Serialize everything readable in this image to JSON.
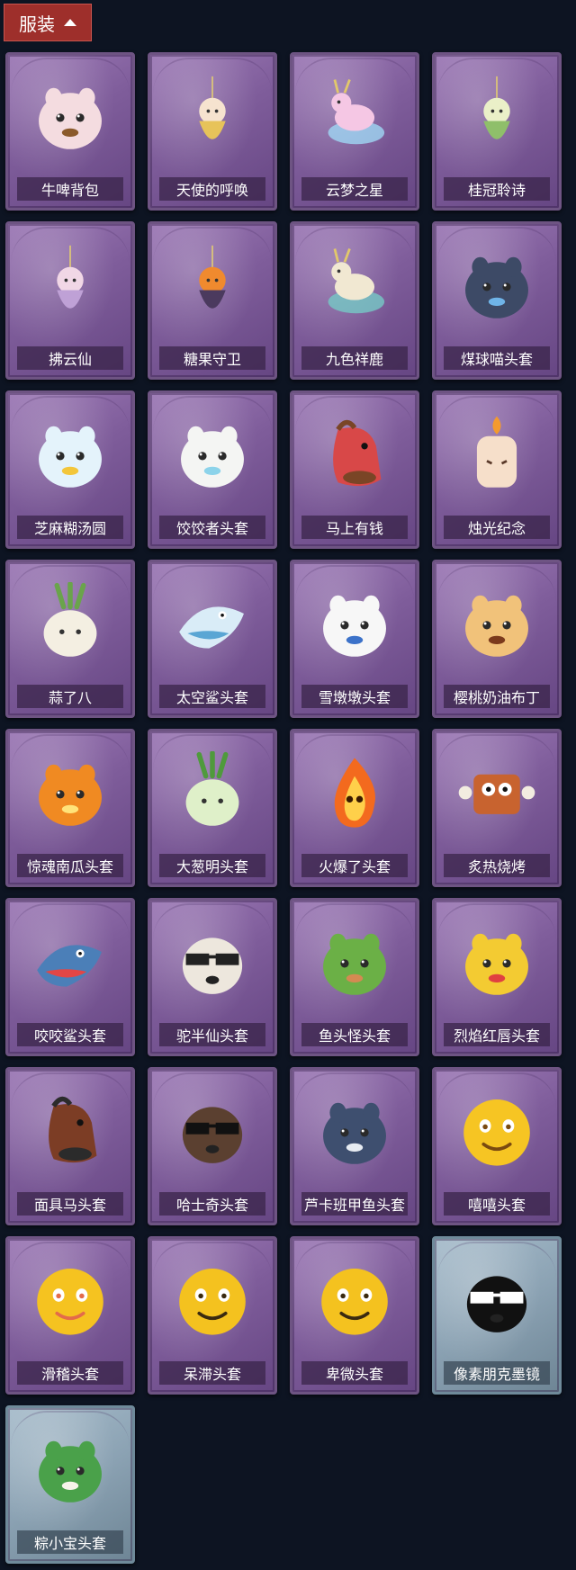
{
  "header": {
    "title": "服装",
    "icon": "chevron-up-icon",
    "color": "#9e2f2b"
  },
  "items": [
    {
      "label": "牛啤背包",
      "color": "#f4dce0",
      "accent": "#8b5a2b",
      "frame": "purple",
      "icon": "cow-beer-backpack-icon"
    },
    {
      "label": "天使的呼唤",
      "color": "#f6e3cf",
      "accent": "#e7c35a",
      "frame": "purple",
      "icon": "angel-pendant-icon"
    },
    {
      "label": "云梦之星",
      "color": "#f5c7e4",
      "accent": "#9fd7f4",
      "frame": "purple",
      "icon": "unicorn-cloud-icon"
    },
    {
      "label": "桂冠聆诗",
      "color": "#eaf0c8",
      "accent": "#8fbf6a",
      "frame": "purple",
      "icon": "laurel-pendant-icon"
    },
    {
      "label": "拂云仙",
      "color": "#f1d7e6",
      "accent": "#bfa1d6",
      "frame": "purple",
      "icon": "cloud-fairy-pendant-icon"
    },
    {
      "label": "糖果守卫",
      "color": "#f08a2e",
      "accent": "#4b3a5e",
      "frame": "purple",
      "icon": "pumpkin-guard-pendant-icon"
    },
    {
      "label": "九色祥鹿",
      "color": "#f1e8d2",
      "accent": "#76c9c6",
      "frame": "purple",
      "icon": "deer-icon"
    },
    {
      "label": "煤球喵头套",
      "color": "#3d4a66",
      "accent": "#6fb4e8",
      "frame": "purple",
      "icon": "black-cat-head-icon"
    },
    {
      "label": "芝麻糊汤圆",
      "color": "#e4f3fb",
      "accent": "#f3c63a",
      "frame": "purple",
      "icon": "tangyuan-head-icon"
    },
    {
      "label": "饺饺者头套",
      "color": "#f4f5f3",
      "accent": "#8cd3ea",
      "frame": "purple",
      "icon": "dumpling-head-icon"
    },
    {
      "label": "马上有钱",
      "color": "#d84848",
      "accent": "#7a4526",
      "frame": "purple",
      "icon": "red-horse-head-icon"
    },
    {
      "label": "烛光纪念",
      "color": "#f6dfca",
      "accent": "#f39a2e",
      "frame": "purple",
      "icon": "candle-head-icon"
    },
    {
      "label": "蒜了八",
      "color": "#f4efe2",
      "accent": "#6aa44b",
      "frame": "purple",
      "icon": "garlic-head-icon"
    },
    {
      "label": "太空鲨头套",
      "color": "#d9ecf7",
      "accent": "#5aa6d4",
      "frame": "purple",
      "icon": "space-shark-head-icon"
    },
    {
      "label": "雪墩墩头套",
      "color": "#f7f7f7",
      "accent": "#3c72c9",
      "frame": "purple",
      "icon": "snowman-head-icon"
    },
    {
      "label": "樱桃奶油布丁",
      "color": "#f1c27a",
      "accent": "#7b3a1c",
      "frame": "purple",
      "icon": "pudding-head-icon"
    },
    {
      "label": "惊魂南瓜头套",
      "color": "#f08a22",
      "accent": "#ffe37a",
      "frame": "purple",
      "icon": "jack-o-lantern-head-icon"
    },
    {
      "label": "大葱明头套",
      "color": "#dff0c9",
      "accent": "#4f9a3c",
      "frame": "purple",
      "icon": "scallion-head-icon"
    },
    {
      "label": "火爆了头套",
      "color": "#f36a1e",
      "accent": "#ffd04a",
      "frame": "purple",
      "icon": "fire-head-icon"
    },
    {
      "label": "炙热烧烤",
      "color": "#c8632f",
      "accent": "#f2ece0",
      "frame": "purple",
      "icon": "bbq-meat-head-icon"
    },
    {
      "label": "咬咬鲨头套",
      "color": "#4b7fb8",
      "accent": "#e24646",
      "frame": "purple",
      "icon": "biting-shark-head-icon"
    },
    {
      "label": "驼半仙头套",
      "color": "#ede7dd",
      "accent": "#222222",
      "frame": "purple",
      "icon": "alpaca-sunglasses-head-icon"
    },
    {
      "label": "鱼头怪头套",
      "color": "#6bb046",
      "accent": "#d48a52",
      "frame": "purple",
      "icon": "fish-head-mask-icon"
    },
    {
      "label": "烈焰红唇头套",
      "color": "#f3cb32",
      "accent": "#e04040",
      "frame": "purple",
      "icon": "pikachu-lips-head-icon"
    },
    {
      "label": "面具马头套",
      "color": "#7c3d25",
      "accent": "#2b2b2b",
      "frame": "purple",
      "icon": "horse-mask-head-icon"
    },
    {
      "label": "哈士奇头套",
      "color": "#5b4030",
      "accent": "#111111",
      "frame": "purple",
      "icon": "husky-sunglasses-head-icon"
    },
    {
      "label": "芦卡班甲鱼头套",
      "color": "#3e4f6f",
      "accent": "#e7ecf2",
      "frame": "purple",
      "icon": "fish-blob-head-icon"
    },
    {
      "label": "嘻嘻头套",
      "color": "#f6c523",
      "accent": "#7a4a10",
      "frame": "purple",
      "icon": "grin-emoji-head-icon"
    },
    {
      "label": "滑稽头套",
      "color": "#f5c320",
      "accent": "#e36b4a",
      "frame": "purple",
      "icon": "smirk-emoji-head-icon"
    },
    {
      "label": "呆滞头套",
      "color": "#f4c21f",
      "accent": "#3a2a10",
      "frame": "purple",
      "icon": "stunned-emoji-head-icon"
    },
    {
      "label": "卑微头套",
      "color": "#f4c21f",
      "accent": "#3a2a10",
      "frame": "purple",
      "icon": "humble-emoji-head-icon"
    },
    {
      "label": "像素朋克墨镜",
      "color": "#111111",
      "accent": "#ffffff",
      "frame": "blue",
      "icon": "pixel-sunglasses-icon"
    },
    {
      "label": "粽小宝头套",
      "color": "#4aa14a",
      "accent": "#f7f4ea",
      "frame": "blue",
      "icon": "zongzi-head-icon"
    }
  ]
}
